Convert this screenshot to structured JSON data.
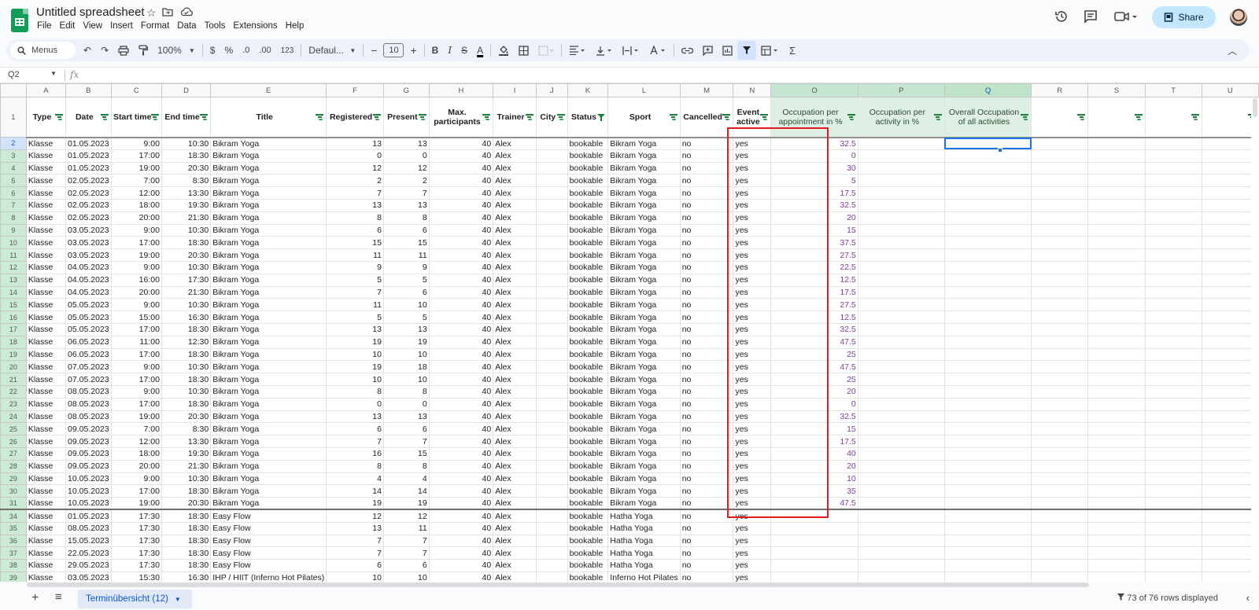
{
  "app": {
    "doc_title": "Untitled spreadsheet",
    "menu": [
      "File",
      "Edit",
      "View",
      "Insert",
      "Format",
      "Data",
      "Tools",
      "Extensions",
      "Help"
    ],
    "share_label": "Share"
  },
  "toolbar": {
    "search_label": "Menus",
    "zoom": "100%",
    "currency": "$",
    "percent": "%",
    "decrease_decimal": ".0",
    "increase_decimal": ".00",
    "number_format": "123",
    "font": "Defaul...",
    "font_size": "10",
    "bold": "B",
    "italic": "I",
    "strike": "S",
    "text_color": "A"
  },
  "formula_bar": {
    "cell_ref": "Q2",
    "fx": "fx",
    "value": ""
  },
  "columns": [
    "A",
    "B",
    "C",
    "D",
    "E",
    "F",
    "G",
    "H",
    "I",
    "J",
    "K",
    "L",
    "M",
    "N",
    "O",
    "P",
    "Q",
    "R",
    "S",
    "T",
    "U"
  ],
  "headers": [
    "Type",
    "Date",
    "Start time",
    "End time",
    "Title",
    "Registered",
    "Present",
    "Max. participants",
    "Trainer",
    "City",
    "Status",
    "Sport",
    "Cancelled",
    "Event active",
    "Occupation per appointment in %",
    "Occupation per activity in %",
    "Overall Occupation of all activities",
    "",
    "",
    "",
    ""
  ],
  "rows": [
    {
      "n": "2",
      "c": [
        "Klasse",
        "01.05.2023",
        "9:00",
        "10:30",
        "Bikram Yoga",
        "13",
        "13",
        "40",
        "Alex",
        "",
        "bookable",
        "Bikram Yoga",
        "no",
        "yes",
        "32.5",
        "",
        ""
      ]
    },
    {
      "n": "3",
      "c": [
        "Klasse",
        "01.05.2023",
        "17:00",
        "18:30",
        "Bikram Yoga",
        "0",
        "0",
        "40",
        "Alex",
        "",
        "bookable",
        "Bikram Yoga",
        "no",
        "yes",
        "0",
        "",
        ""
      ]
    },
    {
      "n": "4",
      "c": [
        "Klasse",
        "01.05.2023",
        "19:00",
        "20:30",
        "Bikram Yoga",
        "12",
        "12",
        "40",
        "Alex",
        "",
        "bookable",
        "Bikram Yoga",
        "no",
        "yes",
        "30",
        "",
        ""
      ]
    },
    {
      "n": "5",
      "c": [
        "Klasse",
        "02.05.2023",
        "7:00",
        "8:30",
        "Bikram Yoga",
        "2",
        "2",
        "40",
        "Alex",
        "",
        "bookable",
        "Bikram Yoga",
        "no",
        "yes",
        "5",
        "",
        ""
      ]
    },
    {
      "n": "6",
      "c": [
        "Klasse",
        "02.05.2023",
        "12:00",
        "13:30",
        "Bikram Yoga",
        "7",
        "7",
        "40",
        "Alex",
        "",
        "bookable",
        "Bikram Yoga",
        "no",
        "yes",
        "17.5",
        "",
        ""
      ]
    },
    {
      "n": "7",
      "c": [
        "Klasse",
        "02.05.2023",
        "18:00",
        "19:30",
        "Bikram Yoga",
        "13",
        "13",
        "40",
        "Alex",
        "",
        "bookable",
        "Bikram Yoga",
        "no",
        "yes",
        "32.5",
        "",
        ""
      ]
    },
    {
      "n": "8",
      "c": [
        "Klasse",
        "02.05.2023",
        "20:00",
        "21:30",
        "Bikram Yoga",
        "8",
        "8",
        "40",
        "Alex",
        "",
        "bookable",
        "Bikram Yoga",
        "no",
        "yes",
        "20",
        "",
        ""
      ]
    },
    {
      "n": "9",
      "c": [
        "Klasse",
        "03.05.2023",
        "9:00",
        "10:30",
        "Bikram Yoga",
        "6",
        "6",
        "40",
        "Alex",
        "",
        "bookable",
        "Bikram Yoga",
        "no",
        "yes",
        "15",
        "",
        ""
      ]
    },
    {
      "n": "10",
      "c": [
        "Klasse",
        "03.05.2023",
        "17:00",
        "18:30",
        "Bikram Yoga",
        "15",
        "15",
        "40",
        "Alex",
        "",
        "bookable",
        "Bikram Yoga",
        "no",
        "yes",
        "37.5",
        "",
        ""
      ]
    },
    {
      "n": "11",
      "c": [
        "Klasse",
        "03.05.2023",
        "19:00",
        "20:30",
        "Bikram Yoga",
        "11",
        "11",
        "40",
        "Alex",
        "",
        "bookable",
        "Bikram Yoga",
        "no",
        "yes",
        "27.5",
        "",
        ""
      ]
    },
    {
      "n": "12",
      "c": [
        "Klasse",
        "04.05.2023",
        "9:00",
        "10:30",
        "Bikram Yoga",
        "9",
        "9",
        "40",
        "Alex",
        "",
        "bookable",
        "Bikram Yoga",
        "no",
        "yes",
        "22.5",
        "",
        ""
      ]
    },
    {
      "n": "13",
      "c": [
        "Klasse",
        "04.05.2023",
        "16:00",
        "17:30",
        "Bikram Yoga",
        "5",
        "5",
        "40",
        "Alex",
        "",
        "bookable",
        "Bikram Yoga",
        "no",
        "yes",
        "12.5",
        "",
        ""
      ]
    },
    {
      "n": "14",
      "c": [
        "Klasse",
        "04.05.2023",
        "20:00",
        "21:30",
        "Bikram Yoga",
        "7",
        "6",
        "40",
        "Alex",
        "",
        "bookable",
        "Bikram Yoga",
        "no",
        "yes",
        "17.5",
        "",
        ""
      ]
    },
    {
      "n": "15",
      "c": [
        "Klasse",
        "05.05.2023",
        "9:00",
        "10:30",
        "Bikram Yoga",
        "11",
        "10",
        "40",
        "Alex",
        "",
        "bookable",
        "Bikram Yoga",
        "no",
        "yes",
        "27.5",
        "",
        ""
      ]
    },
    {
      "n": "16",
      "c": [
        "Klasse",
        "05.05.2023",
        "15:00",
        "16:30",
        "Bikram Yoga",
        "5",
        "5",
        "40",
        "Alex",
        "",
        "bookable",
        "Bikram Yoga",
        "no",
        "yes",
        "12.5",
        "",
        ""
      ]
    },
    {
      "n": "17",
      "c": [
        "Klasse",
        "05.05.2023",
        "17:00",
        "18:30",
        "Bikram Yoga",
        "13",
        "13",
        "40",
        "Alex",
        "",
        "bookable",
        "Bikram Yoga",
        "no",
        "yes",
        "32.5",
        "",
        ""
      ]
    },
    {
      "n": "18",
      "c": [
        "Klasse",
        "06.05.2023",
        "11:00",
        "12:30",
        "Bikram Yoga",
        "19",
        "19",
        "40",
        "Alex",
        "",
        "bookable",
        "Bikram Yoga",
        "no",
        "yes",
        "47.5",
        "",
        ""
      ]
    },
    {
      "n": "19",
      "c": [
        "Klasse",
        "06.05.2023",
        "17:00",
        "18:30",
        "Bikram Yoga",
        "10",
        "10",
        "40",
        "Alex",
        "",
        "bookable",
        "Bikram Yoga",
        "no",
        "yes",
        "25",
        "",
        ""
      ]
    },
    {
      "n": "20",
      "c": [
        "Klasse",
        "07.05.2023",
        "9:00",
        "10:30",
        "Bikram Yoga",
        "19",
        "18",
        "40",
        "Alex",
        "",
        "bookable",
        "Bikram Yoga",
        "no",
        "yes",
        "47.5",
        "",
        ""
      ]
    },
    {
      "n": "21",
      "c": [
        "Klasse",
        "07.05.2023",
        "17:00",
        "18:30",
        "Bikram Yoga",
        "10",
        "10",
        "40",
        "Alex",
        "",
        "bookable",
        "Bikram Yoga",
        "no",
        "yes",
        "25",
        "",
        ""
      ]
    },
    {
      "n": "22",
      "c": [
        "Klasse",
        "08.05.2023",
        "9:00",
        "10:30",
        "Bikram Yoga",
        "8",
        "8",
        "40",
        "Alex",
        "",
        "bookable",
        "Bikram Yoga",
        "no",
        "yes",
        "20",
        "",
        ""
      ]
    },
    {
      "n": "23",
      "c": [
        "Klasse",
        "08.05.2023",
        "17:00",
        "18:30",
        "Bikram Yoga",
        "0",
        "0",
        "40",
        "Alex",
        "",
        "bookable",
        "Bikram Yoga",
        "no",
        "yes",
        "0",
        "",
        ""
      ]
    },
    {
      "n": "24",
      "c": [
        "Klasse",
        "08.05.2023",
        "19:00",
        "20:30",
        "Bikram Yoga",
        "13",
        "13",
        "40",
        "Alex",
        "",
        "bookable",
        "Bikram Yoga",
        "no",
        "yes",
        "32.5",
        "",
        ""
      ]
    },
    {
      "n": "25",
      "c": [
        "Klasse",
        "09.05.2023",
        "7:00",
        "8:30",
        "Bikram Yoga",
        "6",
        "6",
        "40",
        "Alex",
        "",
        "bookable",
        "Bikram Yoga",
        "no",
        "yes",
        "15",
        "",
        ""
      ]
    },
    {
      "n": "26",
      "c": [
        "Klasse",
        "09.05.2023",
        "12:00",
        "13:30",
        "Bikram Yoga",
        "7",
        "7",
        "40",
        "Alex",
        "",
        "bookable",
        "Bikram Yoga",
        "no",
        "yes",
        "17.5",
        "",
        ""
      ]
    },
    {
      "n": "27",
      "c": [
        "Klasse",
        "09.05.2023",
        "18:00",
        "19:30",
        "Bikram Yoga",
        "16",
        "15",
        "40",
        "Alex",
        "",
        "bookable",
        "Bikram Yoga",
        "no",
        "yes",
        "40",
        "",
        ""
      ]
    },
    {
      "n": "28",
      "c": [
        "Klasse",
        "09.05.2023",
        "20:00",
        "21:30",
        "Bikram Yoga",
        "8",
        "8",
        "40",
        "Alex",
        "",
        "bookable",
        "Bikram Yoga",
        "no",
        "yes",
        "20",
        "",
        ""
      ]
    },
    {
      "n": "29",
      "c": [
        "Klasse",
        "10.05.2023",
        "9:00",
        "10:30",
        "Bikram Yoga",
        "4",
        "4",
        "40",
        "Alex",
        "",
        "bookable",
        "Bikram Yoga",
        "no",
        "yes",
        "10",
        "",
        ""
      ]
    },
    {
      "n": "30",
      "c": [
        "Klasse",
        "10.05.2023",
        "17:00",
        "18:30",
        "Bikram Yoga",
        "14",
        "14",
        "40",
        "Alex",
        "",
        "bookable",
        "Bikram Yoga",
        "no",
        "yes",
        "35",
        "",
        ""
      ]
    },
    {
      "n": "31",
      "c": [
        "Klasse",
        "10.05.2023",
        "19:00",
        "20:30",
        "Bikram Yoga",
        "19",
        "19",
        "40",
        "Alex",
        "",
        "bookable",
        "Bikram Yoga",
        "no",
        "yes",
        "47.5",
        "",
        ""
      ]
    },
    {
      "n": "34",
      "c": [
        "Klasse",
        "01.05.2023",
        "17:30",
        "18:30",
        "Easy Flow",
        "12",
        "12",
        "40",
        "Alex",
        "",
        "bookable",
        "Hatha Yoga",
        "no",
        "yes",
        "",
        "",
        ""
      ]
    },
    {
      "n": "35",
      "c": [
        "Klasse",
        "08.05.2023",
        "17:30",
        "18:30",
        "Easy Flow",
        "13",
        "11",
        "40",
        "Alex",
        "",
        "bookable",
        "Hatha Yoga",
        "no",
        "yes",
        "",
        "",
        ""
      ]
    },
    {
      "n": "36",
      "c": [
        "Klasse",
        "15.05.2023",
        "17:30",
        "18:30",
        "Easy Flow",
        "7",
        "7",
        "40",
        "Alex",
        "",
        "bookable",
        "Hatha Yoga",
        "no",
        "yes",
        "",
        "",
        ""
      ]
    },
    {
      "n": "37",
      "c": [
        "Klasse",
        "22.05.2023",
        "17:30",
        "18:30",
        "Easy Flow",
        "7",
        "7",
        "40",
        "Alex",
        "",
        "bookable",
        "Hatha Yoga",
        "no",
        "yes",
        "",
        "",
        ""
      ]
    },
    {
      "n": "38",
      "c": [
        "Klasse",
        "29.05.2023",
        "17:30",
        "18:30",
        "Easy Flow",
        "6",
        "6",
        "40",
        "Alex",
        "",
        "bookable",
        "Hatha Yoga",
        "no",
        "yes",
        "",
        "",
        ""
      ]
    },
    {
      "n": "39",
      "c": [
        "Klasse",
        "03.05.2023",
        "15:30",
        "16:30",
        "IHP / HIIT (Inferno Hot Pilates)",
        "10",
        "10",
        "40",
        "Alex",
        "",
        "bookable",
        "Inferno Hot Pilates",
        "no",
        "yes",
        "",
        "",
        ""
      ]
    }
  ],
  "bottom": {
    "sheet_tab": "Terminübersicht (12)",
    "rows_displayed": "73 of 76 rows displayed"
  },
  "colors": {
    "accent": "#0b57d0",
    "highlight_border": "#e0191e",
    "occupation_text": "#7b3f98",
    "filter_green": "#188038"
  }
}
